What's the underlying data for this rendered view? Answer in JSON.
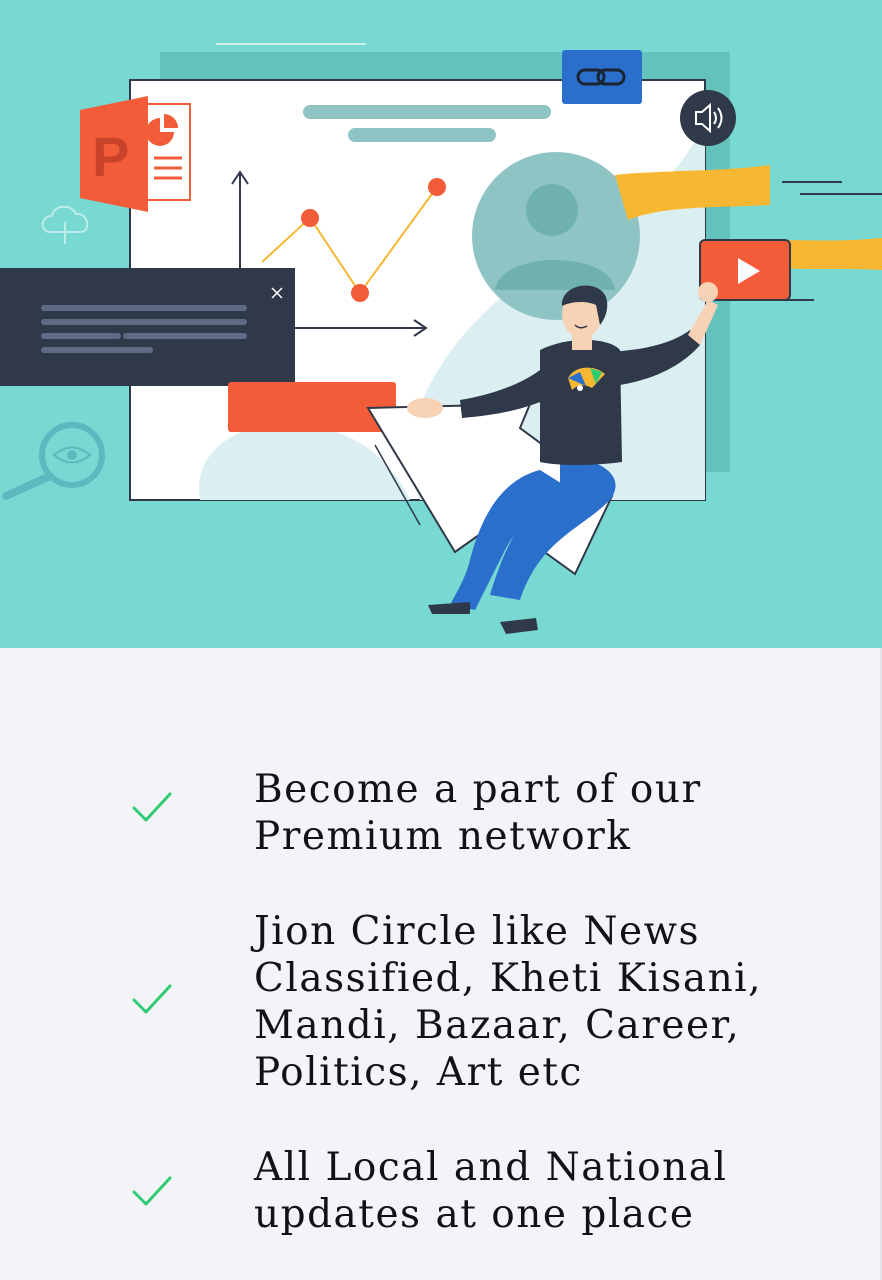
{
  "hero": {
    "illustration": "presentation-illustration",
    "icons": [
      "powerpoint-icon",
      "link-icon",
      "speaker-icon",
      "play-video-icon",
      "search-eye-icon",
      "cloud-upload-icon",
      "close-icon"
    ],
    "colors": {
      "background": "#78d8d2",
      "accent_orange": "#f25c38",
      "accent_blue": "#2a6fcb",
      "accent_yellow": "#f7b733",
      "dark_panel": "#2f3949"
    }
  },
  "features": {
    "items": [
      {
        "icon": "check-icon",
        "text": "Become a part of our Premium network"
      },
      {
        "icon": "check-icon",
        "text": "Jion Circle like News Classified, Kheti Kisani, Mandi, Bazaar, Career, Politics, Art etc"
      },
      {
        "icon": "check-icon",
        "text": "All Local and National updates at one place"
      }
    ],
    "check_color": "#2ecc71"
  }
}
